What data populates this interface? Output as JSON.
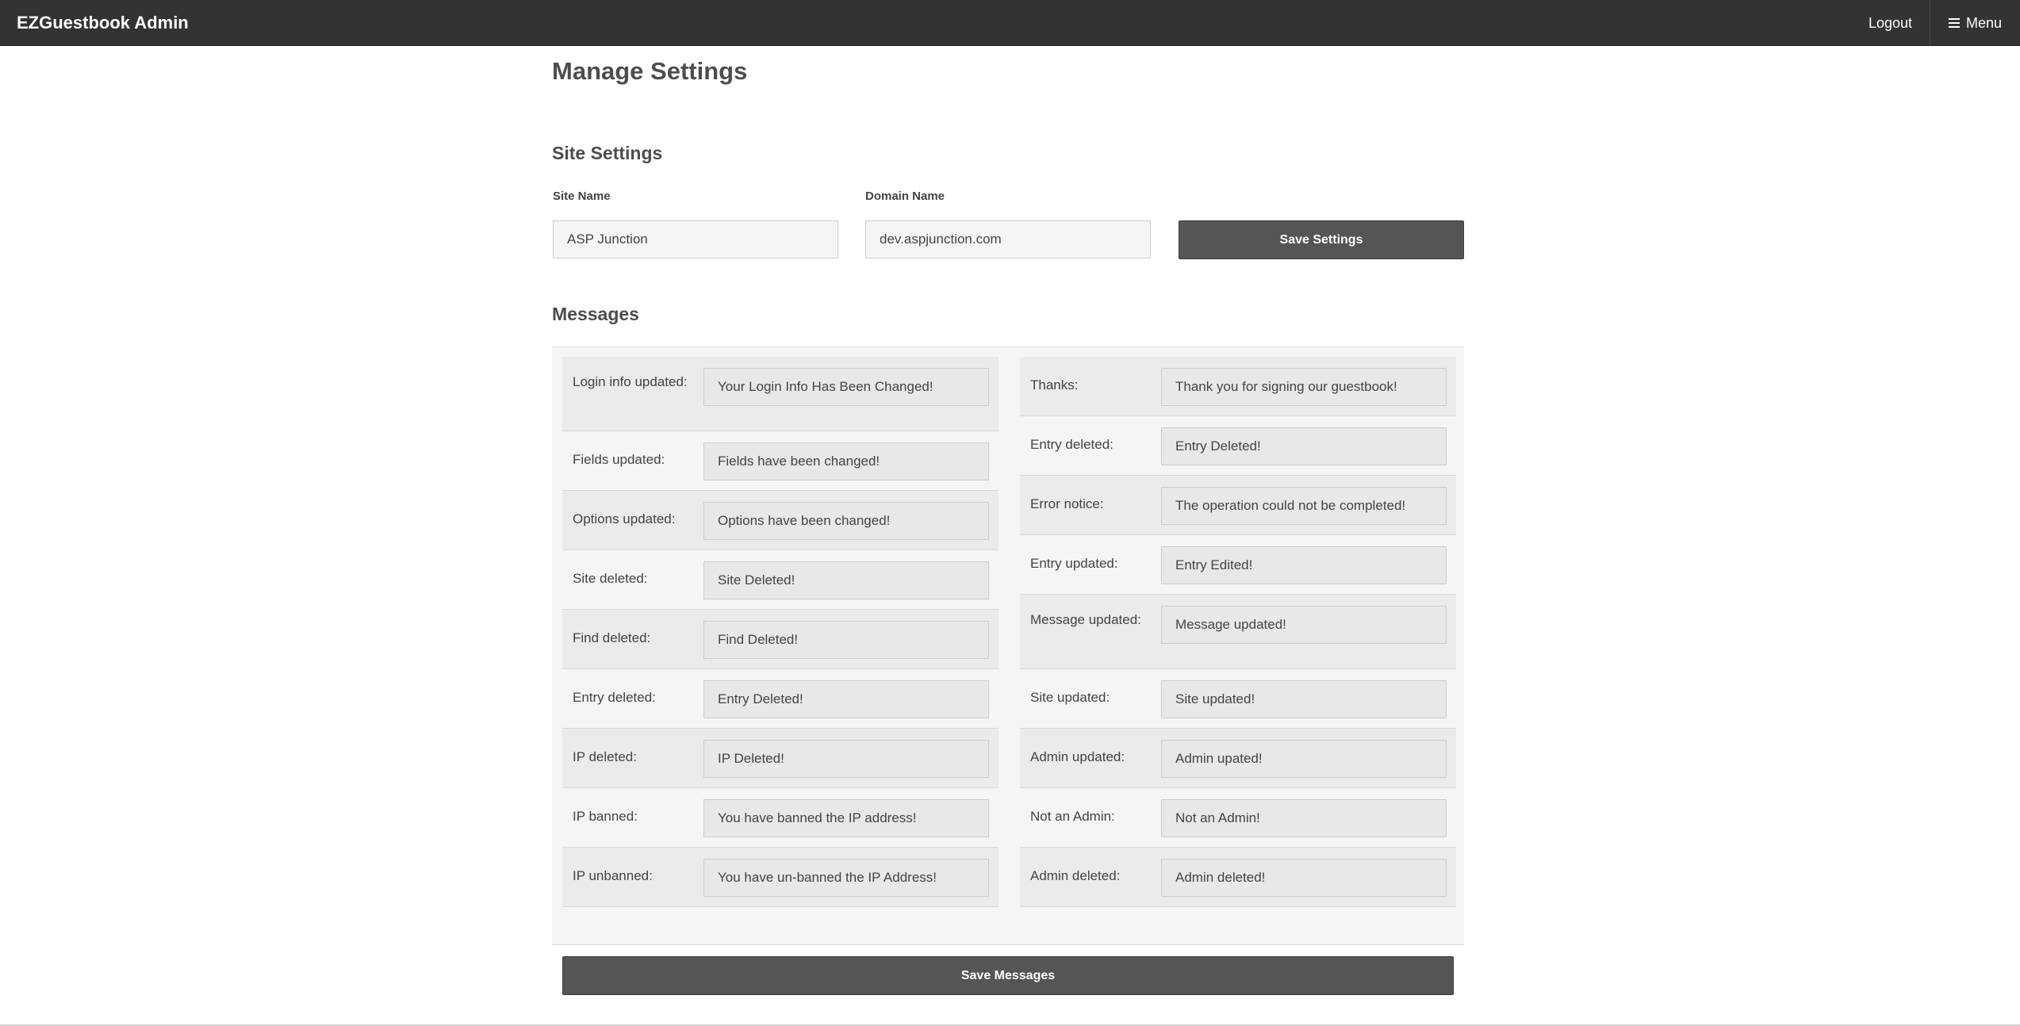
{
  "navbar": {
    "brand": "EZGuestbook Admin",
    "logout_label": "Logout",
    "menu_label": "Menu"
  },
  "page": {
    "title": "Manage Settings"
  },
  "site_settings": {
    "heading": "Site Settings",
    "site_name_label": "Site Name",
    "site_name_value": "ASP Junction",
    "domain_name_label": "Domain Name",
    "domain_name_value": "dev.aspjunction.com",
    "save_label": "Save Settings"
  },
  "messages": {
    "heading": "Messages",
    "left": [
      {
        "label": "Login info updated:",
        "value": "Your Login Info Has Been Changed!"
      },
      {
        "label": "Fields updated:",
        "value": "Fields have been changed!"
      },
      {
        "label": "Options updated:",
        "value": "Options have been changed!"
      },
      {
        "label": "Site deleted:",
        "value": "Site Deleted!"
      },
      {
        "label": "Find deleted:",
        "value": "Find Deleted!"
      },
      {
        "label": "Entry deleted:",
        "value": "Entry Deleted!"
      },
      {
        "label": "IP deleted:",
        "value": "IP Deleted!"
      },
      {
        "label": "IP banned:",
        "value": "You have banned the IP address!"
      },
      {
        "label": "IP unbanned:",
        "value": "You have un-banned the IP Address!"
      }
    ],
    "right": [
      {
        "label": "Thanks:",
        "value": "Thank you for signing our guestbook!"
      },
      {
        "label": "Entry deleted:",
        "value": "Entry Deleted!"
      },
      {
        "label": "Error notice:",
        "value": "The operation could not be completed!"
      },
      {
        "label": "Entry updated:",
        "value": "Entry Edited!"
      },
      {
        "label": "Message updated:",
        "value": "Message updated!"
      },
      {
        "label": "Site updated:",
        "value": "Site updated!"
      },
      {
        "label": "Admin updated:",
        "value": "Admin upated!"
      },
      {
        "label": "Not an Admin:",
        "value": "Not an Admin!"
      },
      {
        "label": "Admin deleted:",
        "value": "Admin deleted!"
      }
    ],
    "save_label": "Save Messages"
  }
}
